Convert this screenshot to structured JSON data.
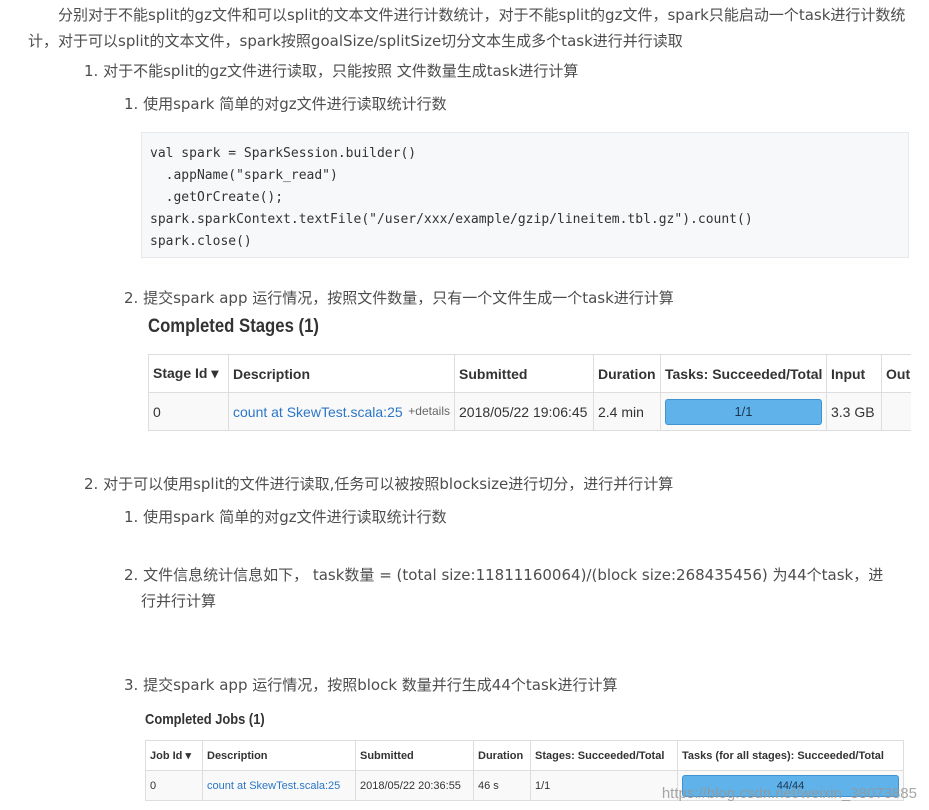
{
  "intro": "分别对于不能split的gz文件和可以split的文本文件进行计数统计，对于不能split的gz文件，spark只能启动一个task进行计数统计，对于可以split的文本文件，spark按照goalSize/splitSize切分文本生成多个task进行并行读取",
  "section1": {
    "title": "1. 对于不能split的gz文件进行读取，只能按照 文件数量生成task进行计算",
    "step1": "1. 使用spark 简单的对gz文件进行读取统计行数",
    "code": [
      "val spark = SparkSession.builder()",
      "  .appName(\"spark_read\")",
      "  .getOrCreate();",
      "spark.sparkContext.textFile(\"/user/xxx/example/gzip/lineitem.tbl.gz\").count()",
      "spark.close()"
    ],
    "step2": "2. 提交spark app 运行情况，按照文件数量，只有一个文件生成一个task进行计算",
    "screenshot": {
      "title": "Completed Stages (1)",
      "headers": [
        "Stage Id ▾",
        "Description",
        "Submitted",
        "Duration",
        "Tasks: Succeeded/Total",
        "Input",
        "Output"
      ],
      "row": {
        "stage_id": "0",
        "description": "count at SkewTest.scala:25",
        "details": "+details",
        "submitted": "2018/05/22 19:06:45",
        "duration": "2.4 min",
        "tasks": "1/1",
        "tasks_fraction": 1.0,
        "input": "3.3 GB"
      }
    }
  },
  "section2": {
    "title": "2. 对于可以使用split的文件进行读取,任务可以被按照blocksize进行切分，进行并行计算",
    "step1": "1. 使用spark 简单的对gz文件进行读取统计行数",
    "step2_line1": "2. 文件信息统计信息如下， task数量 =  (total size:11811160064)/(block size:268435456) 为44个task，进",
    "step2_line2": "行并行计算",
    "step3": "3. 提交spark app 运行情况，按照block 数量并行生成44个task进行计算",
    "screenshot": {
      "title": "Completed Jobs (1)",
      "headers": [
        "Job Id ▾",
        "Description",
        "Submitted",
        "Duration",
        "Stages: Succeeded/Total",
        "Tasks (for all stages): Succeeded/Total"
      ],
      "row": {
        "job_id": "0",
        "description": "count at SkewTest.scala:25",
        "submitted": "2018/05/22 20:36:55",
        "duration": "46 s",
        "stages": "1/1",
        "tasks": "44/44",
        "tasks_fraction": 1.0
      }
    }
  },
  "watermark": "https://blog.csdn.net/weixin_38073885",
  "colors": {
    "link": "#2a76c8",
    "progress": "#5fb3ea",
    "code_bg": "#f6f8fa"
  }
}
